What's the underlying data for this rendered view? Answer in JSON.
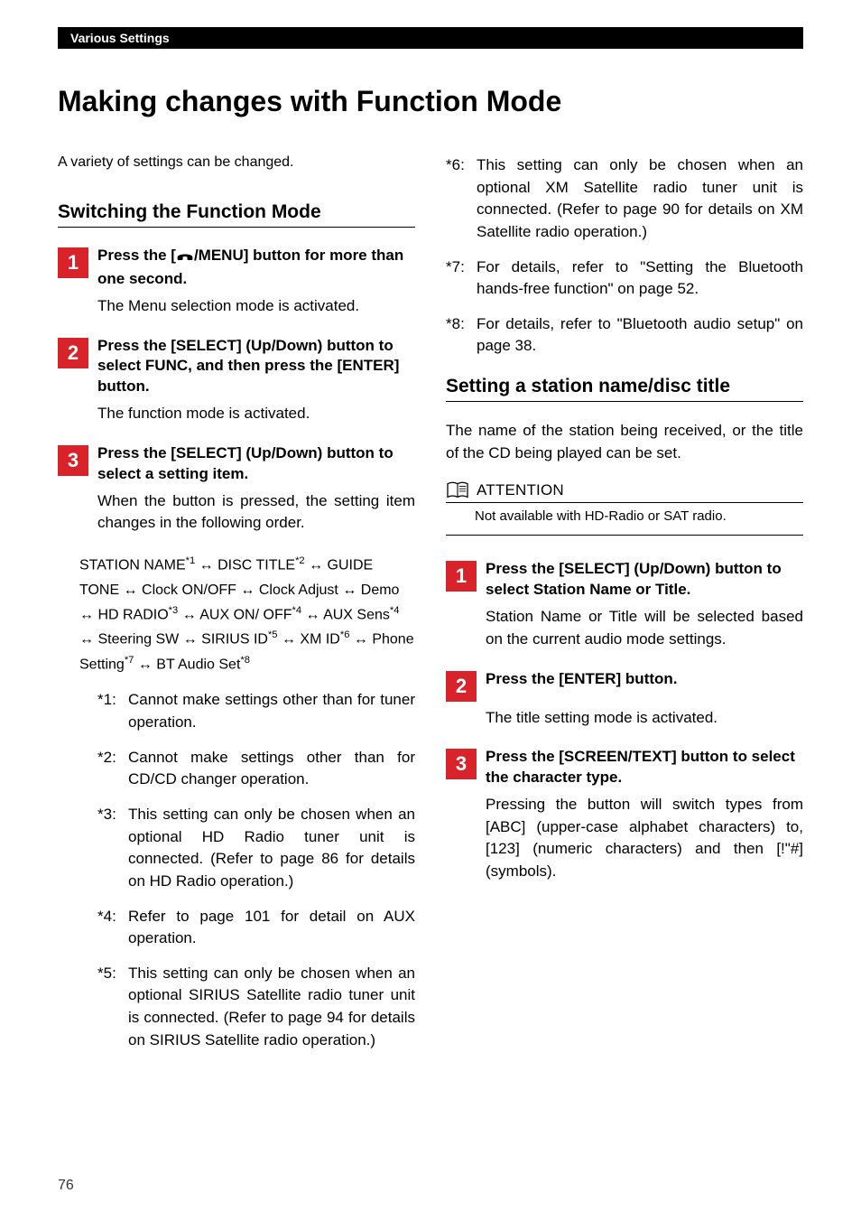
{
  "header": {
    "breadcrumb": "Various Settings"
  },
  "title": "Making changes with Function Mode",
  "left": {
    "intro": "A variety of settings can be changed.",
    "section1": {
      "heading": "Switching the Function Mode",
      "step1": {
        "num": "1",
        "title_pre": "Press the [",
        "title_post": "/MENU] button for more than one second.",
        "body": "The Menu selection mode is activated."
      },
      "step2": {
        "num": "2",
        "title": "Press the [SELECT] (Up/Down) button to select FUNC, and then press the [ENTER] button.",
        "body": "The function mode is activated."
      },
      "step3": {
        "num": "3",
        "title": "Press the [SELECT] (Up/Down) button to select a setting item.",
        "body": "When the button is pressed, the setting item changes in the following order."
      },
      "sequence": {
        "p1": "STATION NAME",
        "s1": "*1",
        "p2": " ↔ DISC TITLE",
        "s2": "*2",
        "p3": " ↔ GUIDE TONE ↔ Clock ON/OFF ↔ Clock Adjust ↔ Demo ↔ HD RADIO",
        "s3": "*3",
        "p4": " ↔ AUX ON/ OFF",
        "s4": "*4",
        "p5": " ↔ AUX Sens",
        "s5": "*4",
        "p6": " ↔ Steering SW ↔ SIRIUS ID",
        "s6": "*5",
        "p7": " ↔ XM ID",
        "s7": "*6",
        "p8": " ↔ Phone Setting",
        "s8": "*7",
        "p9": " ↔ BT Audio Set",
        "s9": "*8"
      },
      "notes": {
        "n1": {
          "label": "*1:",
          "text": "Cannot make settings other than for tuner operation."
        },
        "n2": {
          "label": "*2:",
          "text": "Cannot make settings other than for CD/CD changer operation."
        },
        "n3": {
          "label": "*3:",
          "text": "This setting can only be chosen when an optional HD Radio tuner unit is connected. (Refer to page 86 for details on HD Radio operation.)"
        },
        "n4": {
          "label": "*4:",
          "text": "Refer to page 101 for detail on AUX operation."
        },
        "n5": {
          "label": "*5:",
          "text": "This setting can only be chosen when an optional SIRIUS Satellite radio tuner unit is connected. (Refer to page 94 for details on SIRIUS Satellite radio operation.)"
        }
      }
    }
  },
  "right": {
    "notes": {
      "n6": {
        "label": "*6:",
        "text": "This setting can only be chosen when an optional XM Satellite radio tuner unit is connected. (Refer to page 90 for details on XM Satellite radio operation.)"
      },
      "n7": {
        "label": "*7:",
        "text": "For details, refer to \"Setting the Bluetooth hands-free function\" on page 52."
      },
      "n8": {
        "label": "*8:",
        "text": "For details, refer to \"Bluetooth audio setup\" on page 38."
      }
    },
    "section2": {
      "heading": "Setting a station name/disc title",
      "intro": "The name of the station being received, or the title of the CD being played can be set.",
      "attention_label": "ATTENTION",
      "attention_body": "Not available with HD-Radio or SAT radio.",
      "step1": {
        "num": "1",
        "title": "Press the [SELECT] (Up/Down) button to select Station Name or Title.",
        "body": "Station Name or Title will be selected based on the current audio mode settings."
      },
      "step2": {
        "num": "2",
        "title": "Press the [ENTER] button.",
        "body": "The title setting mode is activated."
      },
      "step3": {
        "num": "3",
        "title": "Press the [SCREEN/TEXT] button to select the character type.",
        "body": "Pressing the button will switch types from [ABC] (upper-case alphabet characters) to, [123] (numeric characters) and then [!\"#] (symbols)."
      }
    }
  },
  "page_number": "76"
}
